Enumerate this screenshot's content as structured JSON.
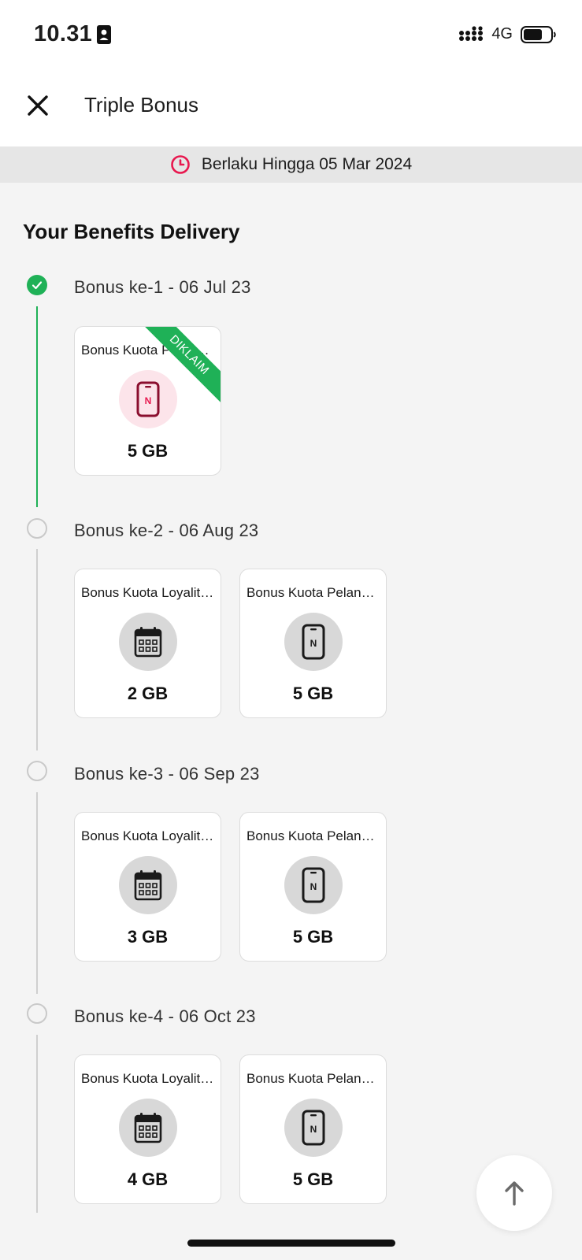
{
  "status_bar": {
    "time": "10.31",
    "network": "4G",
    "icons": [
      "id-badge-icon",
      "signal-icon",
      "battery-icon"
    ]
  },
  "header": {
    "title": "Triple Bonus",
    "close_icon": "close-icon"
  },
  "validity": {
    "icon": "clock-icon",
    "text": "Berlaku Hingga 05 Mar 2024"
  },
  "section": {
    "title": "Your Benefits Delivery"
  },
  "stages": [
    {
      "label": "Bonus ke-1 - 06 Jul 23",
      "status": "claimed",
      "items": [
        {
          "name": "Bonus Kuota Pelanggan",
          "amount": "5 GB",
          "icon": "phone-icon",
          "badge": "DIKLAIM"
        }
      ]
    },
    {
      "label": "Bonus ke-2 - 06 Aug 23",
      "status": "pending",
      "items": [
        {
          "name": "Bonus Kuota Loyalitas",
          "amount": "2 GB",
          "icon": "calendar-icon"
        },
        {
          "name": "Bonus Kuota Pelanggan",
          "amount": "5 GB",
          "icon": "phone-icon"
        }
      ]
    },
    {
      "label": "Bonus ke-3 - 06 Sep 23",
      "status": "pending",
      "items": [
        {
          "name": "Bonus Kuota Loyalitas",
          "amount": "3 GB",
          "icon": "calendar-icon"
        },
        {
          "name": "Bonus Kuota Pelanggan",
          "amount": "5 GB",
          "icon": "phone-icon"
        }
      ]
    },
    {
      "label": "Bonus ke-4 - 06 Oct 23",
      "status": "pending",
      "items": [
        {
          "name": "Bonus Kuota Loyalitas",
          "amount": "4 GB",
          "icon": "calendar-icon"
        },
        {
          "name": "Bonus Kuota Pelanggan",
          "amount": "5 GB",
          "icon": "phone-icon"
        }
      ]
    }
  ],
  "scroll_top": {
    "icon": "arrow-up-icon"
  },
  "colors": {
    "claimed_green": "#1fb157",
    "clock_red": "#e8184f",
    "background": "#f4f4f4"
  }
}
